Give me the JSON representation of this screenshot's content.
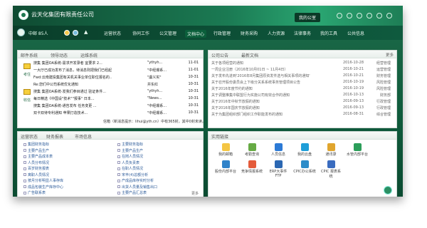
{
  "topbar": {
    "company": "云天化集团有限责任公司",
    "office_button": "我的公室"
  },
  "nav": {
    "user": "中邮 85人",
    "menu": [
      "运营状态",
      "协同工作",
      "公文管理",
      "文档中心",
      "行政管理",
      "财务采购",
      "人力资源",
      "法律事务",
      "我的工具",
      "公共信息"
    ]
  },
  "mail_panel": {
    "tabs": [
      "邮件系统",
      "领导动态",
      "运维系统"
    ],
    "left_labels": [
      "考住",
      "收信"
    ],
    "rows": [
      {
        "subject": "搜集 集团OA系统-需求开发录者 宜要求 2...",
        "sender": "\"ythyh...",
        "date": "11-01"
      },
      {
        "subject": "一大厅已成功发布了消息，待消息则把我们已经起...",
        "sender": "\"中经爆系...",
        "date": "11-01"
      },
      {
        "subject": "Fwd:云南建投集团有关机关事业单位职位报名的...",
        "sender": "\"虞义实\"",
        "date": "10-31"
      },
      {
        "subject": "Re:您们中公司系统优化通知",
        "sender": "井东红",
        "date": "10-31"
      },
      {
        "subject": "搜集 集团OA系统-发我们参目通过 验证条件...",
        "sender": "\"ythyh...",
        "date": "10-31"
      },
      {
        "subject": "每日精选《中国设\"技术\"\"报事\" 日本...",
        "sender": "\"News...",
        "date": "10-31"
      },
      {
        "subject": "搜集 集团OA系统-通告发布 任务变更 ...",
        "sender": "\"中经爆系...",
        "date": "10-31"
      },
      {
        "subject": "双卡双待专利通知 苹果打造技术...",
        "sender": "\"中经爆系...",
        "date": "10-31"
      }
    ],
    "footer": "信箱（新消息提示：lihui@yth.cn）中有365封，其中0封未读。"
  },
  "notice_panel": {
    "tabs": [
      "公司公告",
      "最新文档"
    ],
    "more": "更多",
    "rows": [
      {
        "title": "关于各项经营的通知",
        "date": "2016-10-28",
        "cat": "经营管理"
      },
      {
        "title": "一周企业注册（2016年10月01日 ~ 11月4日）",
        "date": "2016-10-21",
        "cat": "运营管理"
      },
      {
        "title": "关于发布先进到'2016年8月集团原资发件选与相关事项的通知'",
        "date": "2016-10-21",
        "cat": "财务管理"
      },
      {
        "title": "关于召开股份委员会上下级分关系系统事务管理项目公告",
        "date": "2016-10-19",
        "cat": "风险管理"
      },
      {
        "title": "关于2016年度节约的通知",
        "date": "2016-10-19",
        "cat": "风险管理"
      },
      {
        "title": "关于调整推集中联盟行为实施公司有效合作的通知",
        "date": "2016-10-13",
        "cat": "财务部"
      },
      {
        "title": "关于2016年中秋节放假的通知",
        "date": "2016-09-13",
        "cat": "行政管理"
      },
      {
        "title": "关于2016年国庆节放假的通知",
        "date": "2016-09-13",
        "cat": "行政管理"
      },
      {
        "title": "关于为集团组织部门组织工作职能发布的通知",
        "date": "2016-08-31",
        "cat": "综合管理"
      }
    ]
  },
  "status_panel": {
    "tabs": [
      "运营状态",
      "财务报表",
      "市场信息"
    ],
    "more": "更多",
    "left": [
      "集团财务指标",
      "主要产品生产",
      "主要产品成本表",
      "人员分布情况",
      "百岁财务报表",
      "离职人员情况",
      "按月分析明显人事存库",
      "成品包装生产库存中心",
      "广告联系表"
    ],
    "right": [
      "主要财务指标",
      "主要产品生产",
      "在岗人员情况",
      "人员负责表",
      "在职人员情况",
      "宋丰(4)总额分析",
      "产成品库存实时分析",
      "出货人员量及销售出口",
      "主要产品汇总表"
    ]
  },
  "apps_panel": {
    "tabs": [
      "实用链接"
    ],
    "apps": [
      {
        "label": "我的邮箱",
        "color": "#f4c543"
      },
      {
        "label": "考勤查询",
        "color": "#6a4"
      },
      {
        "label": "人员信息",
        "color": "#2c7ad6"
      },
      {
        "label": "我的云盘",
        "color": "#1f9ed8"
      },
      {
        "label": "通讯录",
        "color": "#e0a52e"
      },
      {
        "label": "水管内部平台",
        "color": "#2c9e5a"
      },
      {
        "label": "股份内部平台",
        "color": "#2f82c9"
      },
      {
        "label": "竞争情报系统",
        "color": "#e45b3a"
      },
      {
        "label": "ERP大事件FTP",
        "color": "#2b67b2"
      },
      {
        "label": "CPIC办公系统",
        "color": "#2c8cc9"
      },
      {
        "label": "CPIC 报表系统",
        "color": "#3a6cbf"
      }
    ]
  }
}
